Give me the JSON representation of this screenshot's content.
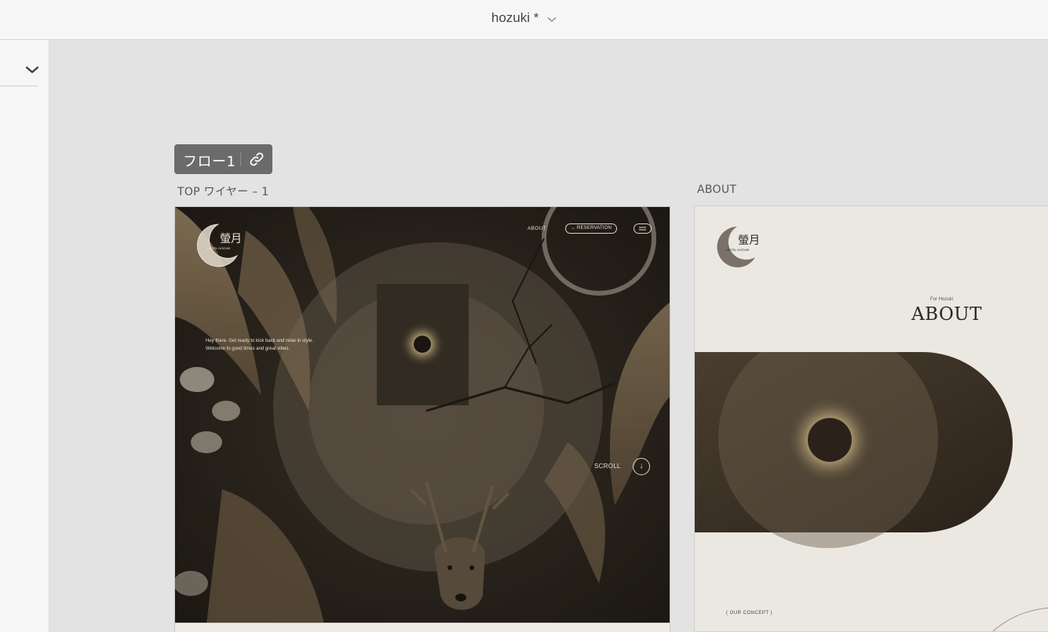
{
  "window": {
    "title": "hozuki *"
  },
  "flow": {
    "label": "フロー1"
  },
  "artboards": [
    {
      "label": "TOP ワイヤー – 1"
    },
    {
      "label": "ABOUT"
    }
  ],
  "top": {
    "logo_subtext": "HOTEL HOZUKI",
    "nav_about": "ABOUT",
    "nav_reservation": "→ RESERVATION",
    "hero_line1": "Hey there. Get ready to kick back and relax in style.",
    "hero_line2": "Welcome to good times and great vibes.",
    "scroll_label": "SCROLL",
    "scroll_arrow": "↓"
  },
  "about": {
    "logo_subtext": "HOTEL HOZUKI",
    "kicker": "For Hozuki",
    "title": "ABOUT",
    "concept": "( OUR CONCEPT )"
  },
  "colors": {
    "toolbar_bg": "#f6f6f6",
    "canvas_bg": "#e3e3e3",
    "flow_badge_bg": "#6b6b6b",
    "about_bg": "#ebe8e2"
  },
  "icons": [
    "chevron-down-icon",
    "link-icon",
    "menu-icon",
    "arrow-down-icon"
  ]
}
